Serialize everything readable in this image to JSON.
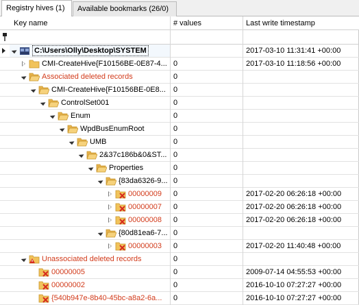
{
  "tabs": [
    {
      "label": "Registry hives (1)",
      "active": true
    },
    {
      "label": "Available bookmarks (26/0)",
      "active": false
    }
  ],
  "columns": {
    "key_name": "Key name",
    "num_values": "# values",
    "last_write": "Last write timestamp"
  },
  "rows": [
    {
      "level": 0,
      "expander": "open",
      "icon": "hive-icon",
      "label": "C:\\Users\\Olly\\Desktop\\SYSTEM",
      "style": "bold",
      "values": "",
      "timestamp": "2017-03-10 11:31:41 +00:00",
      "selected": true
    },
    {
      "level": 1,
      "expander": "closed",
      "icon": "folder-icon",
      "label": "CMI-CreateHive{F10156BE-0E87-4...",
      "style": "normal",
      "values": "0",
      "timestamp": "2017-03-10 11:18:56 +00:00"
    },
    {
      "level": 1,
      "expander": "open",
      "icon": "folder-open-icon",
      "label": "Associated deleted records",
      "style": "red",
      "values": "0",
      "timestamp": ""
    },
    {
      "level": 2,
      "expander": "open",
      "icon": "folder-open-icon",
      "label": "CMI-CreateHive{F10156BE-0E8...",
      "style": "normal",
      "values": "0",
      "timestamp": ""
    },
    {
      "level": 3,
      "expander": "open",
      "icon": "folder-open-icon",
      "label": "ControlSet001",
      "style": "normal",
      "values": "0",
      "timestamp": ""
    },
    {
      "level": 4,
      "expander": "open",
      "icon": "folder-open-icon",
      "label": "Enum",
      "style": "normal",
      "values": "0",
      "timestamp": ""
    },
    {
      "level": 5,
      "expander": "open",
      "icon": "folder-open-icon",
      "label": "WpdBusEnumRoot",
      "style": "normal",
      "values": "0",
      "timestamp": ""
    },
    {
      "level": 6,
      "expander": "open",
      "icon": "folder-open-icon",
      "label": "UMB",
      "style": "normal",
      "values": "0",
      "timestamp": ""
    },
    {
      "level": 7,
      "expander": "open",
      "icon": "folder-open-icon",
      "label": "2&37c186b&0&ST...",
      "style": "normal",
      "values": "0",
      "timestamp": ""
    },
    {
      "level": 8,
      "expander": "open",
      "icon": "folder-open-icon",
      "label": "Properties",
      "style": "normal",
      "values": "0",
      "timestamp": ""
    },
    {
      "level": 9,
      "expander": "open",
      "icon": "folder-open-icon",
      "label": "{83da6326-9...",
      "style": "normal",
      "values": "0",
      "timestamp": ""
    },
    {
      "level": 10,
      "expander": "closed",
      "icon": "deleted-folder-icon",
      "label": "00000009",
      "style": "red",
      "values": "0",
      "timestamp": "2017-02-20 06:26:18 +00:00"
    },
    {
      "level": 10,
      "expander": "closed",
      "icon": "deleted-folder-icon",
      "label": "00000007",
      "style": "red",
      "values": "0",
      "timestamp": "2017-02-20 06:26:18 +00:00"
    },
    {
      "level": 10,
      "expander": "closed",
      "icon": "deleted-folder-icon",
      "label": "00000008",
      "style": "red",
      "values": "0",
      "timestamp": "2017-02-20 06:26:18 +00:00"
    },
    {
      "level": 9,
      "expander": "open",
      "icon": "folder-open-icon",
      "label": "{80d81ea6-7...",
      "style": "normal",
      "values": "0",
      "timestamp": ""
    },
    {
      "level": 10,
      "expander": "closed",
      "icon": "deleted-folder-icon",
      "label": "00000003",
      "style": "red",
      "values": "0",
      "timestamp": "2017-02-20 11:40:48 +00:00"
    },
    {
      "level": 1,
      "expander": "open",
      "icon": "warning-folder-icon",
      "label": "Unassociated deleted records",
      "style": "red",
      "values": "0",
      "timestamp": ""
    },
    {
      "level": 2,
      "expander": "none",
      "icon": "deleted-folder-icon",
      "label": "00000005",
      "style": "red",
      "values": "0",
      "timestamp": "2009-07-14 04:55:53 +00:00"
    },
    {
      "level": 2,
      "expander": "none",
      "icon": "deleted-folder-icon",
      "label": "00000002",
      "style": "red",
      "values": "0",
      "timestamp": "2016-10-10 07:27:27 +00:00"
    },
    {
      "level": 2,
      "expander": "none",
      "icon": "deleted-folder-icon",
      "label": "{540b947e-8b40-45bc-a8a2-6a...",
      "style": "red",
      "values": "0",
      "timestamp": "2016-10-10 07:27:27 +00:00"
    }
  ]
}
